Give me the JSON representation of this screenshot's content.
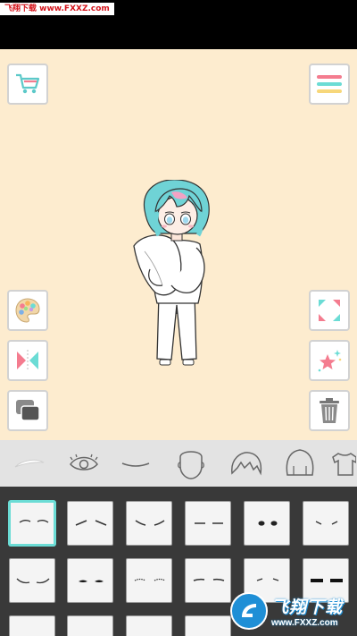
{
  "watermark": {
    "text": "飞翔下载 www.FXXZ.com"
  },
  "toolbar": {
    "left": [
      {
        "name": "shop",
        "icon": "shopping-cart-icon"
      },
      {
        "name": "palette",
        "icon": "color-palette-icon"
      },
      {
        "name": "flip",
        "icon": "flip-horizontal-icon"
      },
      {
        "name": "layers",
        "icon": "layers-icon"
      }
    ],
    "right": [
      {
        "name": "menu",
        "icon": "menu-icon"
      },
      {
        "name": "fullscreen",
        "icon": "fullscreen-icon"
      },
      {
        "name": "random",
        "icon": "sparkle-star-icon"
      },
      {
        "name": "delete",
        "icon": "trash-icon"
      }
    ]
  },
  "categories": [
    {
      "name": "eyebrows",
      "icon": "eyebrow-icon",
      "active": true
    },
    {
      "name": "eyes",
      "icon": "eye-icon",
      "active": false
    },
    {
      "name": "mouth",
      "icon": "mouth-icon",
      "active": false
    },
    {
      "name": "face",
      "icon": "face-icon",
      "active": false
    },
    {
      "name": "front-hair",
      "icon": "front-hair-icon",
      "active": false
    },
    {
      "name": "back-hair",
      "icon": "back-hair-icon",
      "active": false
    },
    {
      "name": "clothes",
      "icon": "shirt-icon",
      "active": false
    }
  ],
  "eyebrow_options": {
    "selected_index": 0,
    "count_visible_rows": 3
  },
  "logo": {
    "cn": "飞翔下载",
    "url": "www.FXXZ.com"
  },
  "colors": {
    "canvas": "#fdeccf",
    "accent_teal": "#6bdcd5",
    "accent_pink": "#f47c8f",
    "accent_yellow": "#f7d77a",
    "panel_dark": "#393939",
    "category_bar": "#e3e3e3"
  }
}
